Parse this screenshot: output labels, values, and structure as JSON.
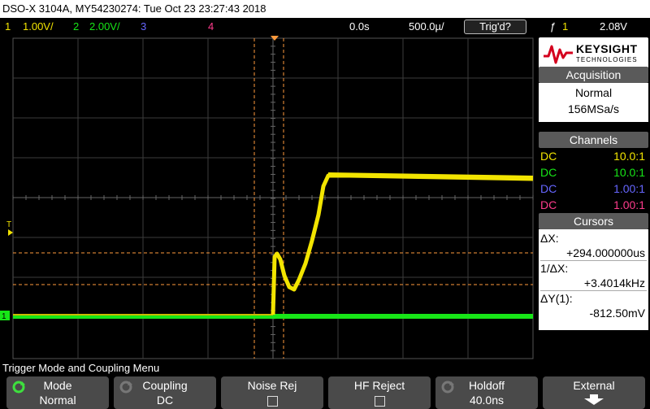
{
  "titlebar": {
    "text": "DSO-X 3104A, MY54230274: Tue Oct 23 23:27:43 2018"
  },
  "statusbar": {
    "ch1_num": "1",
    "ch1_scale": "1.00V/",
    "ch2_num": "2",
    "ch2_scale": "2.00V/",
    "ch3_num": "3",
    "ch4_num": "4",
    "delay": "0.0s",
    "timebase": "500.0µ/",
    "trig_status": "Trig'd?",
    "trig_slope_symbol": "ƒ",
    "trig_source": "1",
    "trig_level": "2.08V"
  },
  "logo": {
    "brand": "KEYSIGHT",
    "sub": "TECHNOLOGIES"
  },
  "acquisition": {
    "header": "Acquisition",
    "mode": "Normal",
    "rate": "156MSa/s"
  },
  "channels": {
    "header": "Channels",
    "rows": [
      {
        "coupling": "DC",
        "probe": "10.0:1",
        "color": "#f2e400"
      },
      {
        "coupling": "DC",
        "probe": "10.0:1",
        "color": "#17e617"
      },
      {
        "coupling": "DC",
        "probe": "1.00:1",
        "color": "#6666ff"
      },
      {
        "coupling": "DC",
        "probe": "1.00:1",
        "color": "#ff3c8c"
      }
    ]
  },
  "cursors": {
    "header": "Cursors",
    "dx_label": "ΔX:",
    "dx_value": "+294.000000us",
    "inv_dx_label": "1/ΔX:",
    "inv_dx_value": "+3.4014kHz",
    "dy_label": "ΔY(1):",
    "dy_value": "-812.50mV"
  },
  "scope": {
    "trigger_marker_label": "T",
    "ground_marker_label": "1",
    "colors": {
      "ch1": "#f2e400",
      "ch2": "#17e617",
      "cursor": "#ff9a3c",
      "grid": "#444444"
    }
  },
  "menu": {
    "title": "Trigger Mode and Coupling Menu",
    "keys": [
      {
        "label": "Mode",
        "value": "Normal",
        "icon": "rotate-knob-icon"
      },
      {
        "label": "Coupling",
        "value": "DC",
        "icon": "rotate-knob-icon"
      },
      {
        "label": "Noise Rej",
        "value": "",
        "icon": "checkbox-icon"
      },
      {
        "label": "HF Reject",
        "value": "",
        "icon": "checkbox-icon"
      },
      {
        "label": "Holdoff",
        "value": "40.0ns",
        "icon": "rotate-knob-icon"
      },
      {
        "label": "External",
        "value": "",
        "icon": "down-arrow-icon"
      }
    ]
  }
}
